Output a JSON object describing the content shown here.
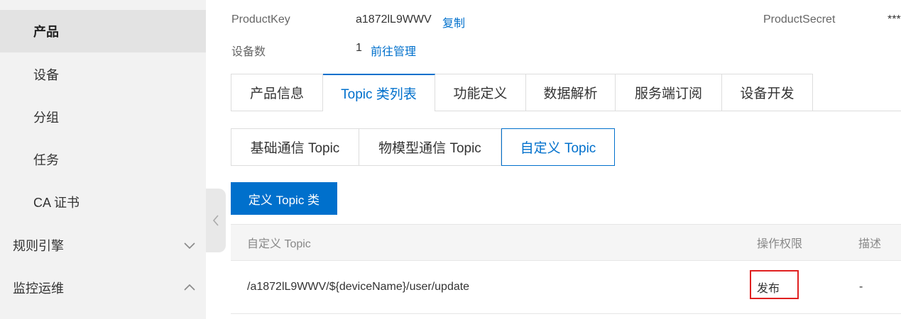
{
  "sidebar": {
    "items": [
      {
        "label": "产品"
      },
      {
        "label": "设备"
      },
      {
        "label": "分组"
      },
      {
        "label": "任务"
      },
      {
        "label": "CA 证书"
      },
      {
        "label": "规则引擎"
      },
      {
        "label": "监控运维"
      }
    ]
  },
  "header": {
    "product_key_label": "ProductKey",
    "product_key_value": "a1872lL9WWV",
    "copy_link": "复制",
    "product_secret_label": "ProductSecret",
    "product_secret_value": "***",
    "device_count_label": "设备数",
    "device_count_value": "1",
    "manage_link": "前往管理"
  },
  "main_tabs": [
    {
      "label": "产品信息"
    },
    {
      "label": "Topic 类列表"
    },
    {
      "label": "功能定义"
    },
    {
      "label": "数据解析"
    },
    {
      "label": "服务端订阅"
    },
    {
      "label": "设备开发"
    }
  ],
  "sub_tabs": [
    {
      "label": "基础通信 Topic"
    },
    {
      "label": "物模型通信 Topic"
    },
    {
      "label": "自定义 Topic"
    }
  ],
  "define_button": "定义 Topic 类",
  "table": {
    "columns": [
      "自定义 Topic",
      "操作权限",
      "描述"
    ],
    "rows": [
      {
        "topic": "/a1872lL9WWV/${deviceName}/user/update",
        "permission": "发布",
        "description": "-"
      }
    ]
  },
  "colors": {
    "accent": "#0070cc",
    "highlight": "#e02020"
  }
}
